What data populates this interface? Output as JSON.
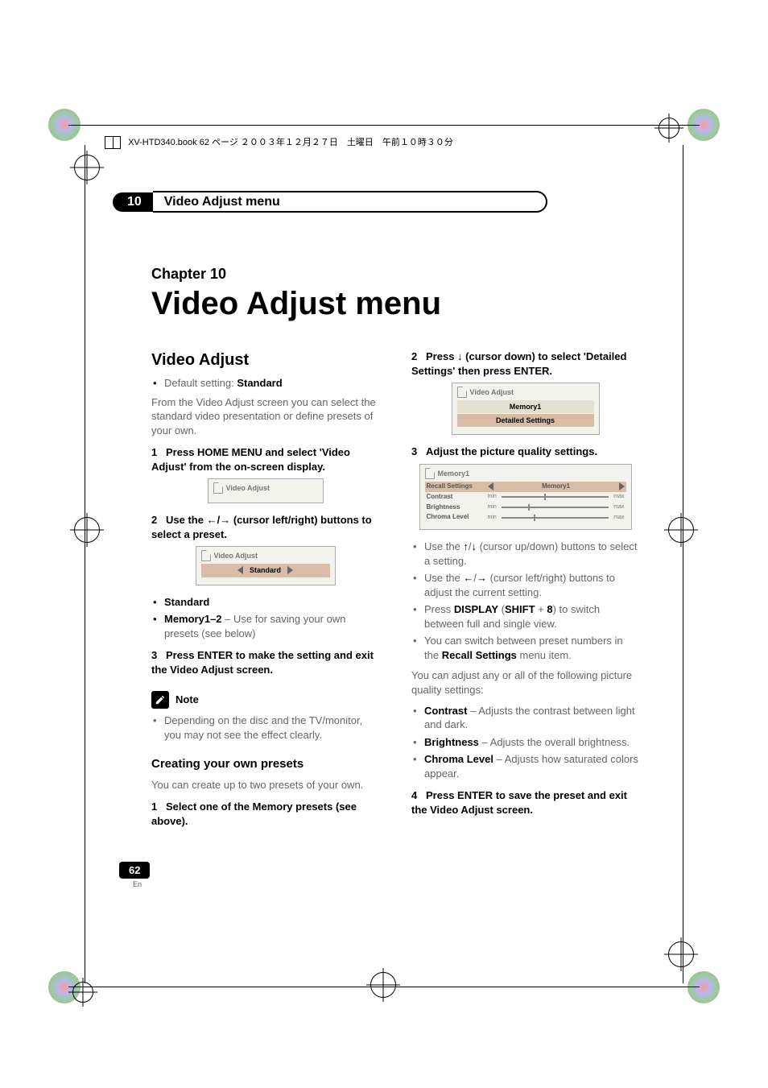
{
  "header_line": "XV-HTD340.book  62 ページ  ２００３年１２月２７日　土曜日　午前１０時３０分",
  "running_head": {
    "number": "10",
    "title": "Video Adjust menu"
  },
  "chapter_label": "Chapter 10",
  "page_title": "Video Adjust menu",
  "page_number": "62",
  "page_lang": "En",
  "left": {
    "h2": "Video Adjust",
    "default_label": "Default setting: ",
    "default_value": "Standard",
    "intro": "From the Video Adjust screen you can select the standard video presentation or define presets of your own.",
    "step1": "Press HOME MENU and select 'Video Adjust' from the on-screen display.",
    "ui1_title": "Video Adjust",
    "step2_pre": "Use the ",
    "step2_post": " (cursor left/right) buttons to select a preset.",
    "ui2_title": "Video Adjust",
    "ui2_value": "Standard",
    "opt_standard": "Standard",
    "opt_memory_label": "Memory1–2",
    "opt_memory_desc": " – Use for saving your own presets (see below)",
    "step3": "Press ENTER to make the setting and exit the Video Adjust screen.",
    "note_label": "Note",
    "note_text": "Depending on the disc and the TV/monitor, you may not see the effect clearly.",
    "h3": "Creating your own presets",
    "h3_intro": "You can create up to two presets of your own.",
    "c_step1": "Select one of the Memory presets (see above)."
  },
  "right": {
    "step2_pre": "Press ",
    "step2_post": " (cursor down) to select 'Detailed Settings' then press ENTER.",
    "ui3_title": "Video Adjust",
    "ui3_row1": "Memory1",
    "ui3_row2": "Detailed Settings",
    "step3": "Adjust the picture quality settings.",
    "ui4_title": "Memory1",
    "ui4_recall": "Recall Settings",
    "ui4_recall_val": "Memory1",
    "ui4_rows": [
      "Contrast",
      "Brightness",
      "Chroma Level"
    ],
    "ui4_min": "min",
    "ui4_max": "max",
    "b1_pre": "Use the ",
    "b1_post": " (cursor up/down) buttons to select a setting.",
    "b2_pre": "Use the ",
    "b2_post": " (cursor left/right) buttons to adjust the current setting.",
    "b3_pre": "Press ",
    "b3_b1": "DISPLAY",
    "b3_mid": " (",
    "b3_b2": "SHIFT",
    "b3_plus": " + ",
    "b3_b3": "8",
    "b3_post": ") to switch between full and single view.",
    "b4_pre": "You can switch between preset numbers in the ",
    "b4_b": "Recall Settings",
    "b4_post": " menu item.",
    "adjust_any": "You can adjust any or all of the following picture quality settings:",
    "q1_b": "Contrast",
    "q1_t": " – Adjusts the contrast between light and dark.",
    "q2_b": "Brightness",
    "q2_t": " – Adjusts the overall brightness.",
    "q3_b": "Chroma Level",
    "q3_t": " – Adjusts how saturated colors appear.",
    "step4": "Press ENTER to save the preset and exit the Video Adjust screen."
  },
  "nums": {
    "n1": "1",
    "n2": "2",
    "n3": "3",
    "n4": "4"
  }
}
